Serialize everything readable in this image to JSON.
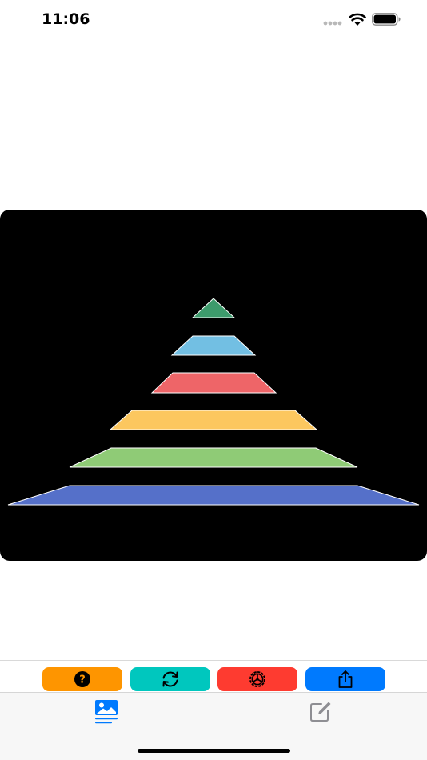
{
  "status_bar": {
    "time": "11:06"
  },
  "pyramid": {
    "background": "#000000",
    "outline": "#ffffff",
    "levels": [
      {
        "color": "#3d9b6c",
        "shape": "triangle"
      },
      {
        "color": "#72bfe3",
        "shape": "trapezoid"
      },
      {
        "color": "#ee6568",
        "shape": "trapezoid"
      },
      {
        "color": "#fcc75f",
        "shape": "trapezoid"
      },
      {
        "color": "#8fcb76",
        "shape": "trapezoid"
      },
      {
        "color": "#5570c9",
        "shape": "trapezoid"
      }
    ]
  },
  "toolbar": {
    "buttons": [
      {
        "name": "help",
        "icon": "question-circle-icon",
        "color": "#fe9500"
      },
      {
        "name": "refresh",
        "icon": "refresh-arrows-icon",
        "color": "#00c7be"
      },
      {
        "name": "settings",
        "icon": "gear-icon",
        "color": "#fe3b30"
      },
      {
        "name": "share",
        "icon": "share-icon",
        "color": "#007afe"
      }
    ]
  },
  "tabbar": {
    "tabs": [
      {
        "name": "image",
        "icon": "photo-text-icon",
        "selected": true,
        "color": "#007afe"
      },
      {
        "name": "edit",
        "icon": "square-pencil-icon",
        "selected": false,
        "color": "#8e8e93"
      }
    ]
  }
}
